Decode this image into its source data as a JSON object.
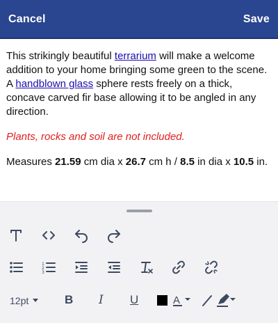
{
  "header": {
    "cancel_label": "Cancel",
    "save_label": "Save",
    "background_color": "#2a4690"
  },
  "content": {
    "p1_part1": "This strikingly beautiful ",
    "p1_link1": "terrarium",
    "p1_part2": " will make a welcome addition to your home bringing some green to the scene. A ",
    "p1_link2": "handblown glass",
    "p1_part3": " sphere rests freely on a thick, concave carved fir base allowing it to be angled in any direction.",
    "p2_note": "Plants, rocks and soil are not included.",
    "p3_part1": "Measures ",
    "p3_b1": "21.59",
    "p3_part2": " cm dia x ",
    "p3_b2": "26.7",
    "p3_part3": " cm h / ",
    "p3_b3": "8.5",
    "p3_part4": " in dia x ",
    "p3_b4": "10.5",
    "p3_part5": " in.",
    "note_color": "#e01e1e",
    "link_color": "#1a0dab"
  },
  "toolbar": {
    "font_size": "12pt",
    "bold_label": "B",
    "italic_label": "I",
    "underline_label": "U",
    "text_color_label": "A",
    "text_color_value": "#000000",
    "icons_row1": [
      "text-format-icon",
      "code-view-icon",
      "undo-icon",
      "redo-icon"
    ],
    "icons_row2": [
      "bulleted-list-icon",
      "numbered-list-icon",
      "indent-icon",
      "outdent-icon",
      "clear-format-icon",
      "link-icon",
      "unlink-icon"
    ],
    "icons_row3": [
      "text-color-icon",
      "highlight-icon",
      "marker-icon"
    ]
  }
}
